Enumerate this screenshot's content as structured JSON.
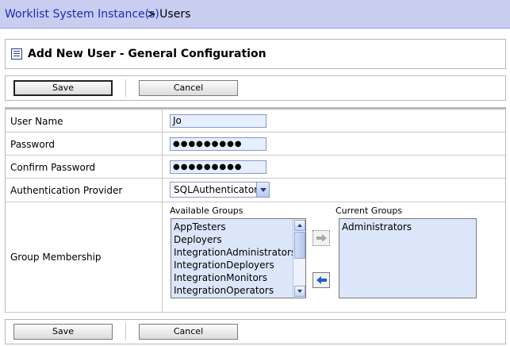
{
  "breadcrumb": {
    "link": "Worklist System Instance(s)",
    "current": "> Users"
  },
  "header": {
    "title": "Add New User - General Configuration",
    "icon": "list-icon"
  },
  "toolbar": {
    "save_label": "Save",
    "cancel_label": "Cancel"
  },
  "form": {
    "user_name": {
      "label": "User Name",
      "value": "Jo"
    },
    "password": {
      "label": "Password",
      "value": "●●●●●●●●●"
    },
    "confirm_password": {
      "label": "Confirm Password",
      "value": "●●●●●●●●●"
    },
    "auth_provider": {
      "label": "Authentication Provider",
      "value": "SQLAuthenticator"
    },
    "group_membership": {
      "label": "Group Membership",
      "available_label": "Available Groups",
      "current_label": "Current Groups",
      "available": [
        "AppTesters",
        "Deployers",
        "IntegrationAdministrators",
        "IntegrationDeployers",
        "IntegrationMonitors",
        "IntegrationOperators"
      ],
      "current": [
        "Administrators"
      ]
    }
  },
  "colors": {
    "breadcrumb_bg": "#c9cdf0",
    "link": "#1a2bb8",
    "input_bg": "#e6efff"
  }
}
